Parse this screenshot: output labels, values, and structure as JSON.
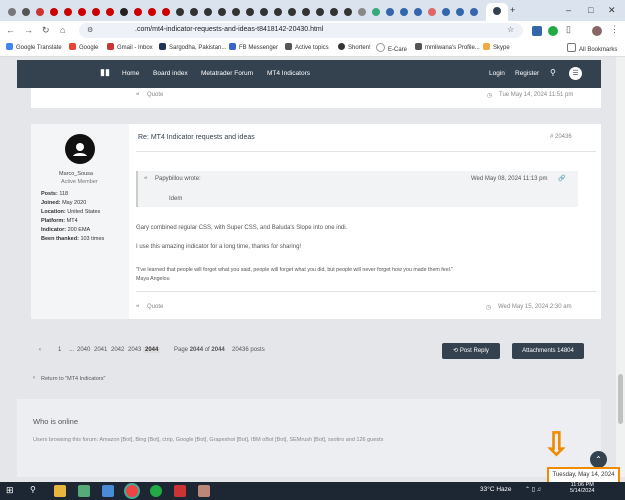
{
  "browser": {
    "url": ".com/mt4-indicator-requests-and-ideas-t8418142-20430.html",
    "bookmarks": [
      "Google Translate",
      "Google",
      "Gmail - Inbox",
      "Sargodha, Pakistan...",
      "FB Messenger",
      "Active topics",
      "Shorten!",
      "E-Care",
      "mmliwana's Profile...",
      "Skype",
      "All Bookmarks"
    ]
  },
  "nav": {
    "items": [
      "Home",
      "Board index",
      "Metatrader Forum",
      "MT4 Indicators"
    ],
    "login": "Login",
    "register": "Register"
  },
  "prev_post": {
    "quote": "Quote",
    "date": "Tue May 14, 2024 11:51 pm"
  },
  "post": {
    "title": "Re: MT4 Indicator requests and ideas",
    "number": "# 20436",
    "author": "Marco_Sousa",
    "rank": "Active Member",
    "profile": [
      {
        "label": "Posts:",
        "value": "118"
      },
      {
        "label": "Joined:",
        "value": "May 2020"
      },
      {
        "label": "Location:",
        "value": "United States"
      },
      {
        "label": "Platform:",
        "value": "MT4"
      },
      {
        "label": "Indicator:",
        "value": "200 EMA"
      },
      {
        "label": "Been thanked:",
        "value": "103 times"
      }
    ],
    "quote_author": "Papybillou wrote:",
    "quote_date": "Wed May 08, 2024 11:13 pm",
    "quote_text": "Idem",
    "line1": "Gary combined regular CSS, with Super CSS, and Baluda's Slope into one indi.",
    "line2": "I use this amazing indicator for a long time, thanks for sharing!",
    "line3": "\"I've learned that people will forget what you said, people will forget what you did, but people will never forget how you made them feel.\"",
    "line4": "Maya Angelou",
    "quote_btn": "Quote",
    "date": "Wed May 15, 2024 2:30 am"
  },
  "pagination": {
    "pages": [
      "1",
      "...",
      "2040",
      "2041",
      "2042",
      "2043",
      "2044"
    ],
    "page_label": "Page",
    "current": "2044",
    "of": "of",
    "total": "2044",
    "posts": "20436 posts"
  },
  "post_reply": "Post Reply",
  "attachments": "Attachments 14804",
  "return": "Return to \"MT4 Indicators\"",
  "who_online": {
    "title": "Who is online",
    "text": "Users browsing this forum: Amazon [Bot], Bing [Bot], ctrip, Google [Bot], Grapeshot [Bot], IBM oBot [Bot], SEMrush [Bot], ssotiro and 126 guests"
  },
  "date_popup": "Tuesday, May 14, 2024",
  "taskbar": {
    "weather": "33°C  Haze",
    "time": "11:06 PM",
    "date": "5/14/2024"
  }
}
